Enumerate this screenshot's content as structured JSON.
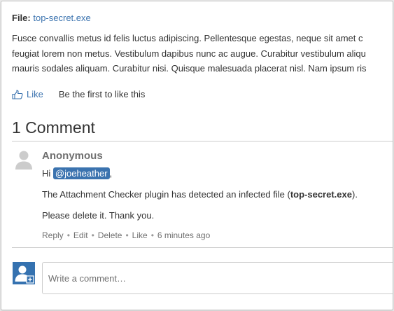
{
  "file": {
    "label": "File:",
    "name": "top-secret.exe"
  },
  "body_lines": [
    " Fusce convallis metus id felis luctus adipiscing. Pellentesque egestas, neque sit amet c",
    "feugiat lorem non metus. Vestibulum dapibus nunc ac augue. Curabitur vestibulum aliqu",
    "mauris sodales aliquam. Curabitur nisi. Quisque malesuada placerat nisl. Nam ipsum ris"
  ],
  "like": {
    "label": "Like",
    "message": "Be the first to like this"
  },
  "comments": {
    "heading": "1 Comment",
    "items": [
      {
        "author": "Anonymous",
        "greeting": "Hi",
        "mention": "@joeheather",
        "greeting_suffix": ",",
        "text_prefix": "The Attachment Checker plugin has detected an infected file (",
        "text_bold": "top-secret.exe",
        "text_suffix": ").",
        "line3": "Please delete it. Thank you.",
        "actions": {
          "reply": "Reply",
          "edit": "Edit",
          "delete": "Delete",
          "like": "Like",
          "time": "6 minutes ago",
          "separator": "•"
        }
      }
    ]
  },
  "new_comment": {
    "placeholder": "Write a comment…"
  },
  "colors": {
    "link": "#3b73af",
    "mention_bg": "#3b73af",
    "muted": "#707070",
    "avatar_gray": "#cccccc",
    "user_avatar": "#3572b0"
  },
  "icons": {
    "like": "thumbs-up-icon",
    "anonymous_avatar": "default-user-avatar-icon",
    "current_user_avatar": "user-add-avatar-icon"
  }
}
